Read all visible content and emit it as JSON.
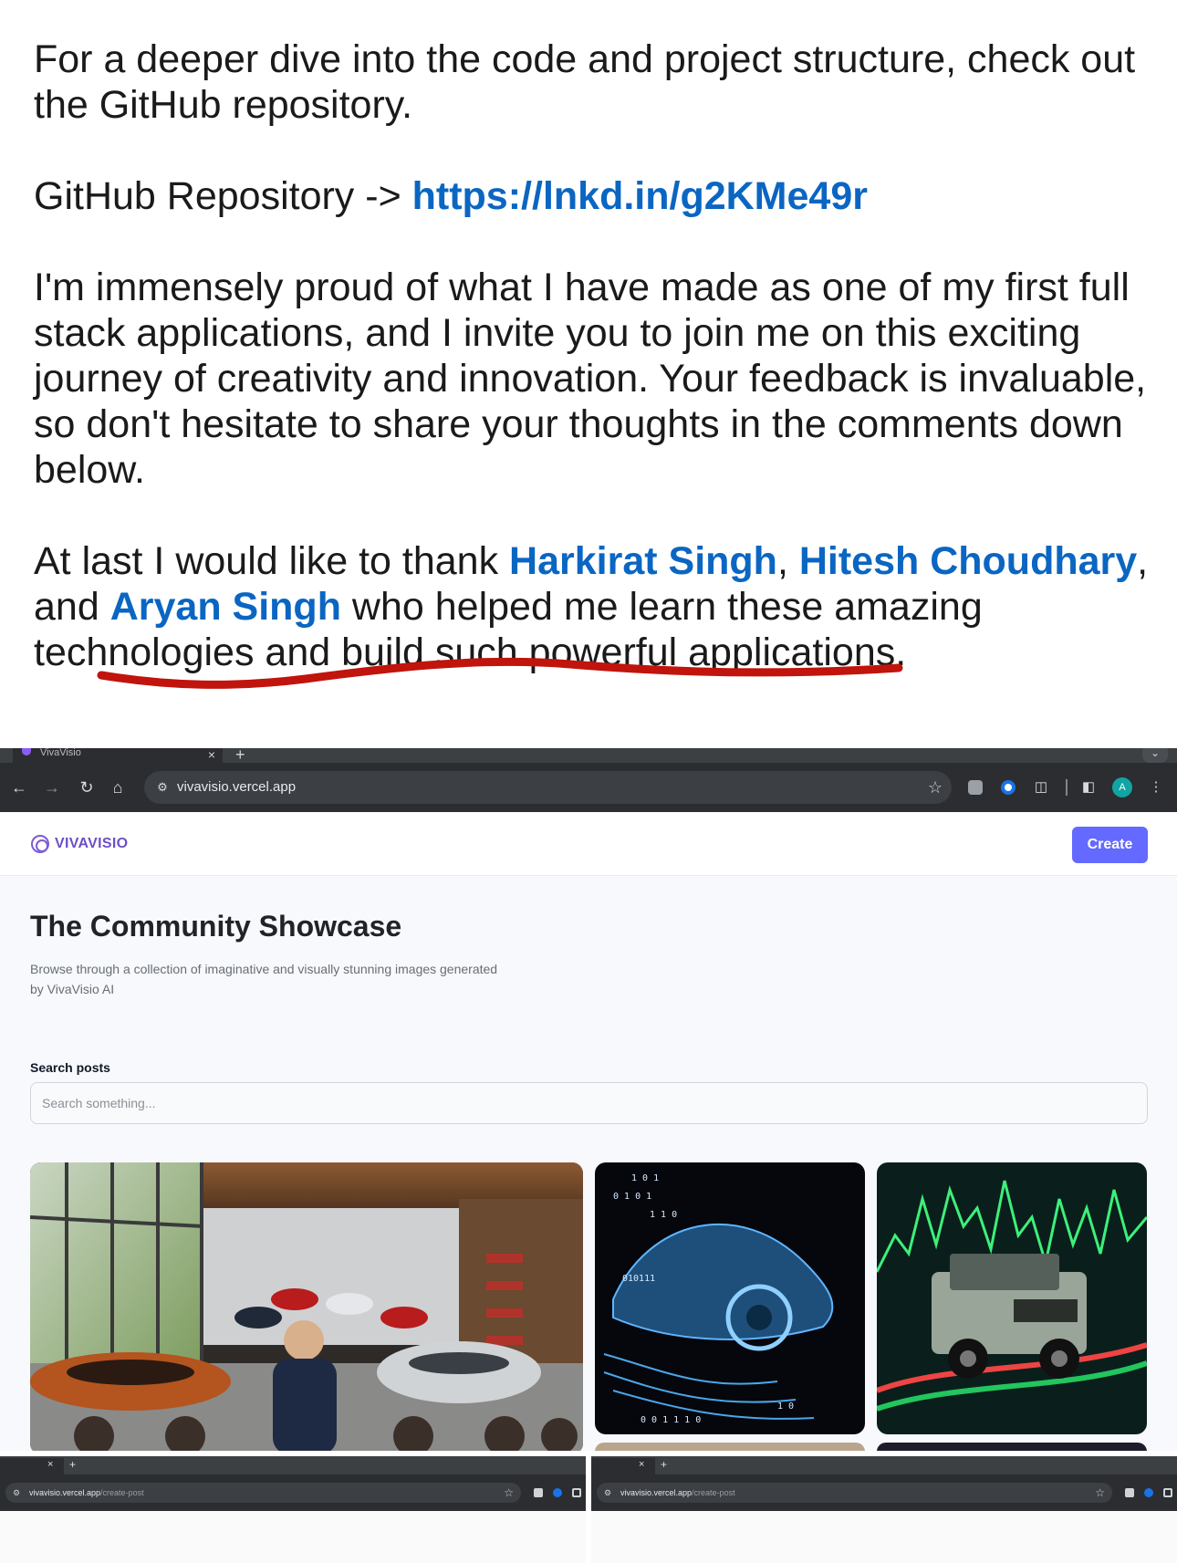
{
  "post": {
    "para1": "For a deeper dive into the code and project structure, check out the GitHub repository.",
    "repo_label": "GitHub Repository -> ",
    "repo_link": "https://lnkd.in/g2KMe49r",
    "para3": "I'm immensely proud of what I have made as one of my first full stack applications, and I invite you to join me on this exciting journey of creativity and innovation. Your feedback is invaluable, so don't hesitate to share your thoughts in the comments down below.",
    "thanks_prefix": "At last I would like to thank ",
    "mention1": "Harkirat Singh",
    "sep1": ", ",
    "mention2": "Hitesh Choudhary",
    "sep2": ", and ",
    "mention3": "Aryan Singh",
    "thanks_suffix": " who helped me learn these amazing technologies and build such powerful applications.",
    "link_color": "#0a66c2"
  },
  "browser": {
    "tab_title": "VivaVisio",
    "tab_close": "×",
    "new_tab": "+",
    "url": "vivavisio.vercel.app",
    "avatar_initial": "A",
    "icons": [
      "back-arrow-icon",
      "forward-arrow-icon",
      "reload-icon",
      "home-icon",
      "site-settings-icon",
      "star-icon",
      "extension-icon",
      "puzzle-icon",
      "sidepanel-icon",
      "menu-dots-icon"
    ]
  },
  "site": {
    "logo": "VIVAVISIO",
    "create_button": "Create",
    "title": "The Community Showcase",
    "subtitle": "Browse through a collection of imaginative and visually stunning images generated by VivaVisio AI",
    "search_label": "Search posts",
    "search_placeholder": "Search something...",
    "accent": "#6469ff"
  },
  "mini_browsers": {
    "close": "×",
    "new_tab": "+",
    "url_host": "vivavisio.vercel.app",
    "url_path": "/create-post"
  }
}
